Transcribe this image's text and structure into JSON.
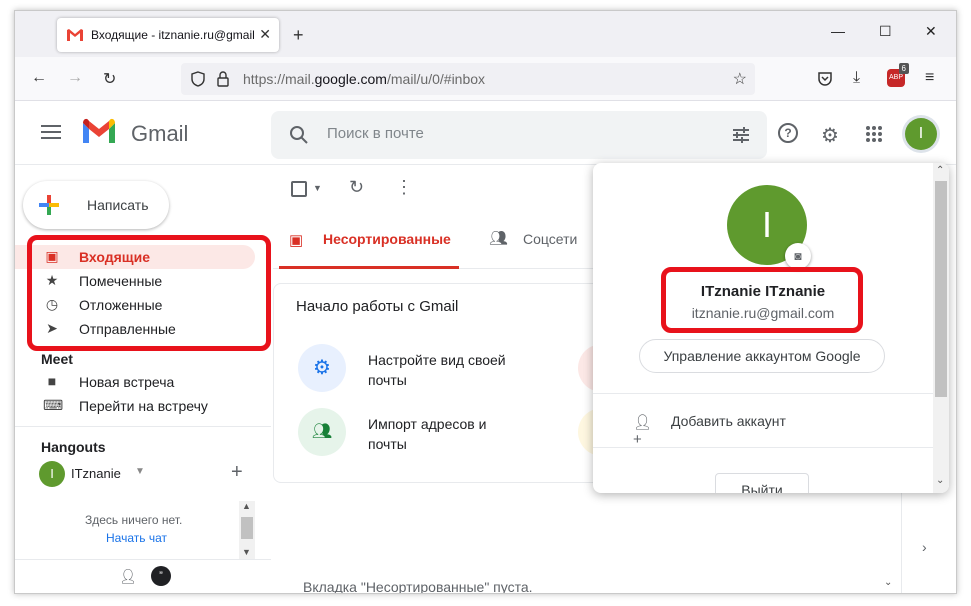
{
  "browser": {
    "tab_title": "Входящие - itznanie.ru@gmail.com - Gmail",
    "url_prefix": "https://mail.",
    "url_domain": "google.com",
    "url_path": "/mail/u/0/#inbox",
    "new_tab_symbol": "+",
    "extension_badge": "6",
    "extension_label": "ABP"
  },
  "header": {
    "app_name": "Gmail",
    "search_placeholder": "Поиск в почте",
    "avatar_letter": "I"
  },
  "sidebar": {
    "compose_label": "Написать",
    "items": [
      {
        "label": "Входящие",
        "icon": "inbox-icon",
        "active": true
      },
      {
        "label": "Помеченные",
        "icon": "star-icon"
      },
      {
        "label": "Отложенные",
        "icon": "clock-icon"
      },
      {
        "label": "Отправленные",
        "icon": "send-icon"
      }
    ],
    "meet": {
      "title": "Meet",
      "items": [
        {
          "label": "Новая встреча",
          "icon": "video-icon"
        },
        {
          "label": "Перейти на встречу",
          "icon": "keyboard-icon"
        }
      ]
    },
    "hangouts": {
      "title": "Hangouts",
      "user": "ITznanie",
      "user_letter": "I",
      "empty_text": "Здесь ничего нет.",
      "start_chat": "Начать чат"
    }
  },
  "main": {
    "tabs": [
      {
        "label": "Несортированные",
        "active": true
      },
      {
        "label": "Соцсети"
      }
    ],
    "getting_started": {
      "title": "Начало работы с Gmail",
      "items": [
        {
          "text": "Настройте вид своей почты",
          "icon": "settings-icon"
        },
        {
          "text": "Импорт адресов и почты",
          "icon": "add-contacts-icon"
        }
      ]
    },
    "empty_message": "Вкладка \"Несортированные\" пуста."
  },
  "account_popup": {
    "avatar_letter": "I",
    "name": "ITznanie ITznanie",
    "email": "itznanie.ru@gmail.com",
    "manage_button": "Управление аккаунтом Google",
    "add_account": "Добавить аккаунт",
    "logout": "Выйти"
  },
  "colors": {
    "accent_red": "#d93025",
    "highlight_box": "#e8121b",
    "avatar_green": "#5f9a2e"
  }
}
